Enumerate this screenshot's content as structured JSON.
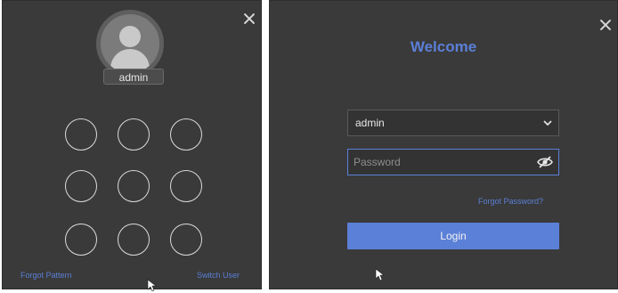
{
  "pattern_screen": {
    "username": "admin",
    "forgot_pattern_label": "Forgot Pattern",
    "switch_user_label": "Switch User",
    "close_icon": "close-icon",
    "avatar_icon": "user-avatar-icon",
    "pattern_grid": {
      "rows": 3,
      "cols": 3
    }
  },
  "login_screen": {
    "title": "Welcome",
    "username_value": "admin",
    "password_placeholder": "Password",
    "forgot_password_label": "Forgot Password?",
    "login_label": "Login",
    "close_icon": "close-icon",
    "dropdown_icon": "chevron-down-icon",
    "password_visibility_icon": "eye-off-icon"
  },
  "colors": {
    "panel_background": "#3a3a3a",
    "accent": "#5b80d8",
    "text": "#e8e8e8"
  }
}
